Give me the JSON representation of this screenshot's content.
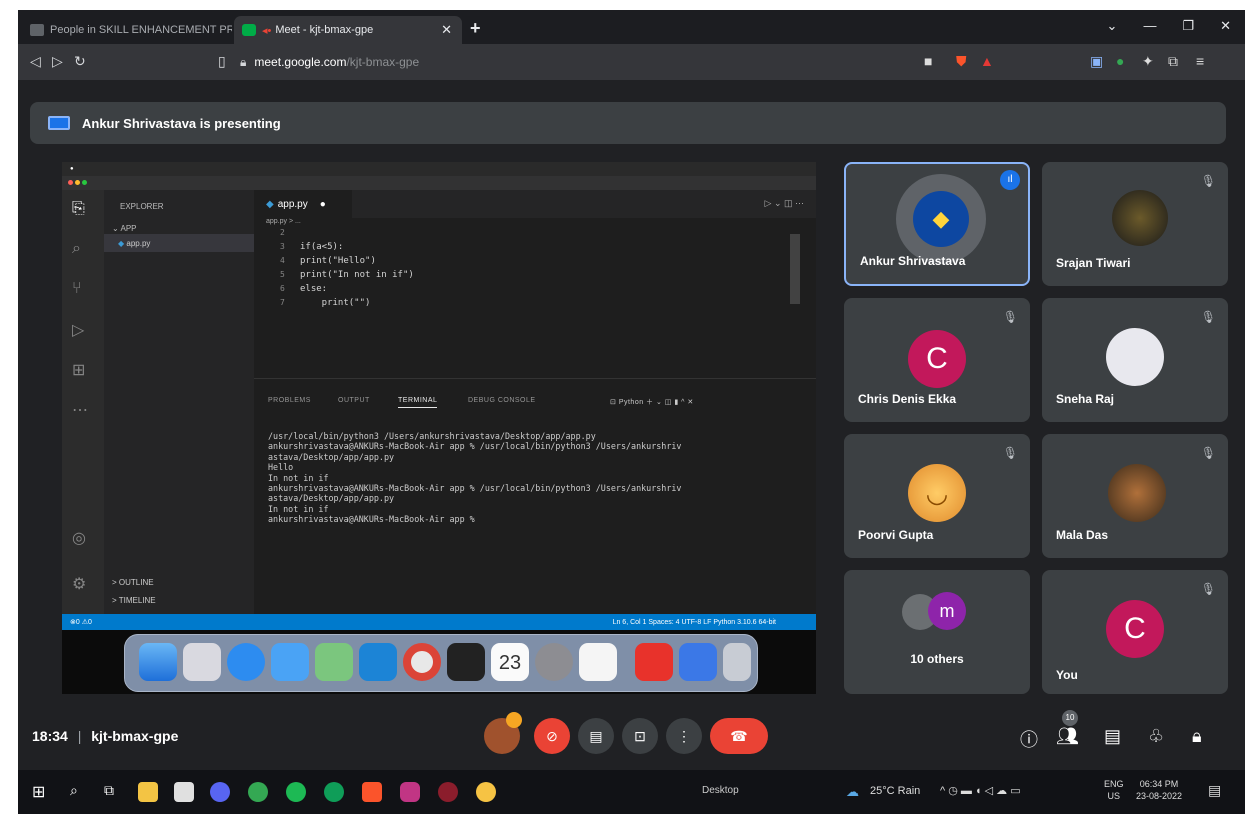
{
  "browser": {
    "tabs": [
      {
        "label": "People in SKILL ENHANCEMENT PRO",
        "active": false
      },
      {
        "label": "Meet - kjt-bmax-gpe",
        "active": true
      }
    ],
    "new_tab": "+",
    "url_host": "meet.google.com",
    "url_path": "/kjt-bmax-gpe"
  },
  "meet": {
    "banner_text": "Ankur Shrivastava is presenting",
    "time": "18:34",
    "meeting_code": "kjt-bmax-gpe",
    "participant_count_badge": "10",
    "tiles": [
      {
        "name": "Ankur Shrivastava",
        "avatar": "python-logo",
        "speaking": true
      },
      {
        "name": "Srajan Tiwari",
        "avatar": "photo"
      },
      {
        "name": "Chris Denis Ekka",
        "avatar_letter": "C",
        "avatar_color": "#c2185b"
      },
      {
        "name": "Sneha Raj",
        "avatar": "photo"
      },
      {
        "name": "Poorvi Gupta",
        "avatar": "smiley"
      },
      {
        "name": "Mala Das",
        "avatar": "photo"
      },
      {
        "name": "10 others",
        "avatar_letter": "m",
        "avatar_color": "#8e24aa"
      },
      {
        "name": "You",
        "avatar_letter": "C",
        "avatar_color": "#c2185b"
      }
    ]
  },
  "vscode": {
    "explorer_label": "EXPLORER",
    "folder": "APP",
    "file": "app.py",
    "tab_label": "app.py",
    "breadcrumb": "app.py > ...",
    "outline": "> OUTLINE",
    "timeline": "> TIMELINE",
    "code_lines": [
      {
        "no": "2",
        "text": ""
      },
      {
        "no": "3",
        "text": "if(a<5):"
      },
      {
        "no": "4",
        "text": "print(\"Hello\")"
      },
      {
        "no": "5",
        "text": "print(\"In not in if\")"
      },
      {
        "no": "6",
        "text": "else:"
      },
      {
        "no": "7",
        "text": "    print(\"\")"
      }
    ],
    "panel_tabs": [
      "PROBLEMS",
      "OUTPUT",
      "TERMINAL",
      "DEBUG CONSOLE"
    ],
    "panel_python": "Python",
    "terminal_lines": [
      "/usr/local/bin/python3 /Users/ankurshrivastava/Desktop/app/app.py",
      "ankurshrivastava@ANKURs-MacBook-Air app % /usr/local/bin/python3 /Users/ankurshriv",
      "astava/Desktop/app/app.py",
      "Hello",
      "In not in if",
      "ankurshrivastava@ANKURs-MacBook-Air app % /usr/local/bin/python3 /Users/ankurshriv",
      "astava/Desktop/app/app.py",
      "In not in if",
      "ankurshrivastava@ANKURs-MacBook-Air app %"
    ],
    "status_left": "⊗0 ⚠0",
    "status_right": "Ln 6, Col 1   Spaces: 4   UTF-8   LF   Python   3.10.6 64-bit",
    "dock_calendar_day": "23"
  },
  "taskbar": {
    "desktop_label": "Desktop",
    "weather": "25°C  Rain",
    "lang_top": "ENG",
    "lang_bottom": "US",
    "clock_time": "06:34 PM",
    "clock_date": "23-08-2022"
  },
  "colors": {
    "meet_bg": "#202124",
    "tile_bg": "#3c4043",
    "end_call": "#ea4335",
    "vscode_status": "#007acc"
  }
}
